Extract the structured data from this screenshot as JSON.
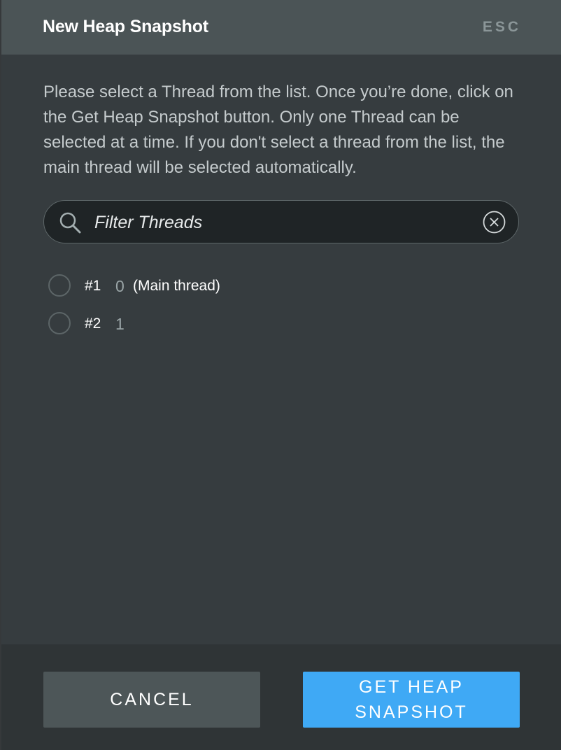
{
  "dialog": {
    "title": "New Heap Snapshot",
    "close_label": "ESC",
    "description": "Please select a Thread from the list. Once you’re done, click on the Get Heap Snapshot button. Only one Thread can be selected at a time. If you don't select a thread from the list, the main thread will be selected automatically."
  },
  "search": {
    "placeholder": "Filter Threads",
    "value": "",
    "icon": "search-icon",
    "clear_icon": "clear-circle-x-icon"
  },
  "threads": [
    {
      "number": "#1",
      "id": "0",
      "name": "(Main thread)",
      "selected": false
    },
    {
      "number": "#2",
      "id": "1",
      "name": "",
      "selected": false
    }
  ],
  "footer": {
    "cancel_label": "CANCEL",
    "submit_label": "GET HEAP SNAPSHOT"
  },
  "colors": {
    "header_bg": "#4b5456",
    "body_bg": "#363c3f",
    "footer_bg": "#2f3436",
    "primary_button": "#3fa9f5",
    "secondary_button": "#4d5658"
  }
}
